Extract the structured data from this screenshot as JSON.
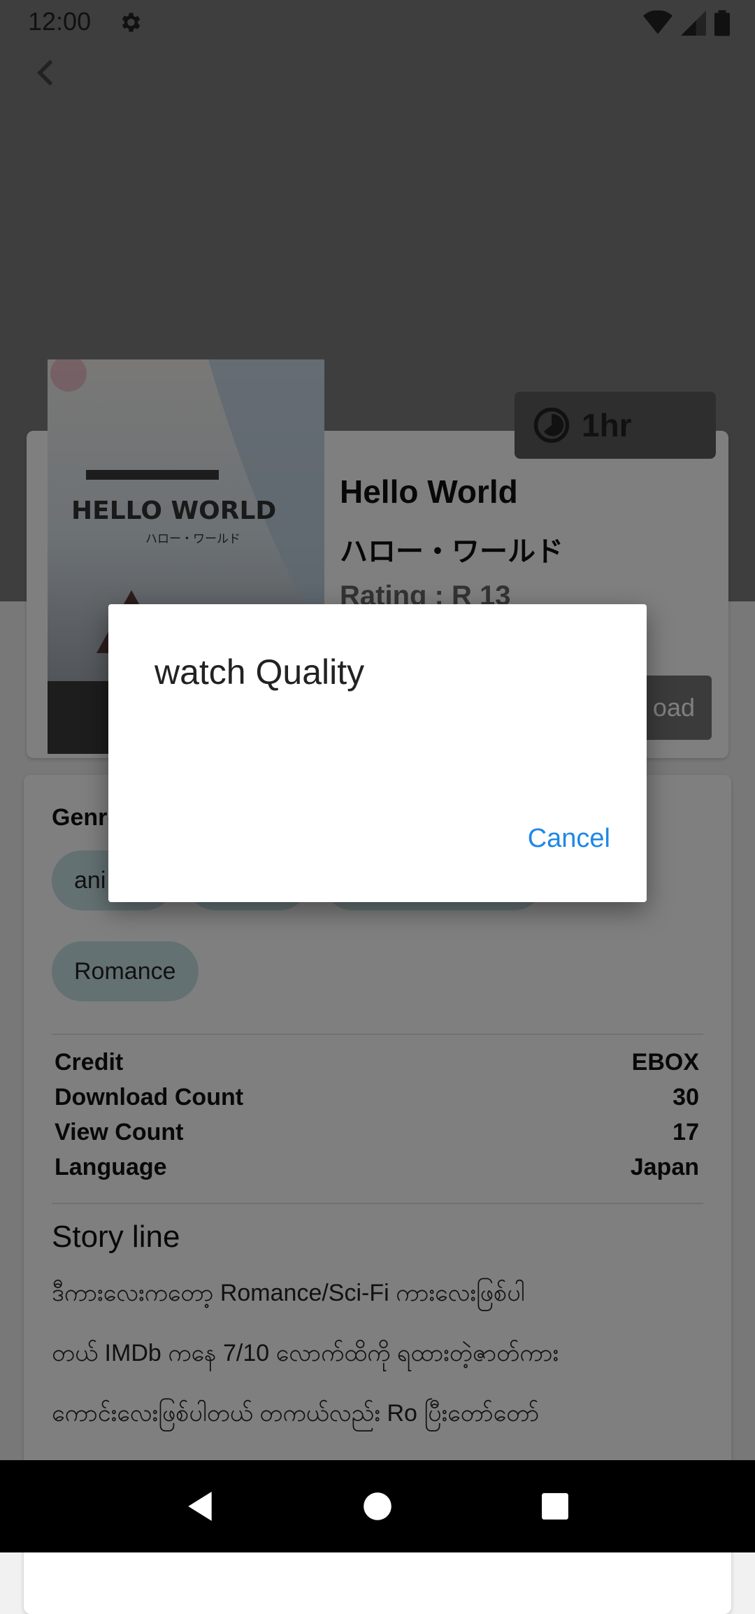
{
  "status": {
    "time": "12:00"
  },
  "movie": {
    "title_en": "Hello World",
    "title_jp": "ハロー・ワールド",
    "rating": "Rating : R 13",
    "duration": "1hr",
    "download_label": "oad",
    "poster_title": "HELLO WORLD",
    "poster_subtitle": "ハロー・ワールド"
  },
  "genres": {
    "label": "Genre",
    "items": [
      "ani",
      "",
      "",
      "Romance"
    ]
  },
  "stats": [
    {
      "label": "Credit",
      "value": "EBOX"
    },
    {
      "label": "Download Count",
      "value": "30"
    },
    {
      "label": "View Count",
      "value": "17"
    },
    {
      "label": "Language",
      "value": "Japan"
    }
  ],
  "story": {
    "title": "Story line",
    "lines": [
      "ဒီကားလေးကတော့ Romance/Sci-Fi ကားလေးဖြစ်ပါ",
      "တယ် IMDb ကနေ 7/10 လောက်ထိကို ရထားတဲ့ဇာတ်ကား",
      "ကောင်းလေးဖြစ်ပါတယ် တကယ်လည်း Ro ပြီးတော်တော်"
    ]
  },
  "dialog": {
    "title": "watch Quality",
    "cancel": "Cancel"
  },
  "colors": {
    "accent": "#1e88e5",
    "chip": "#c9e3e6"
  }
}
